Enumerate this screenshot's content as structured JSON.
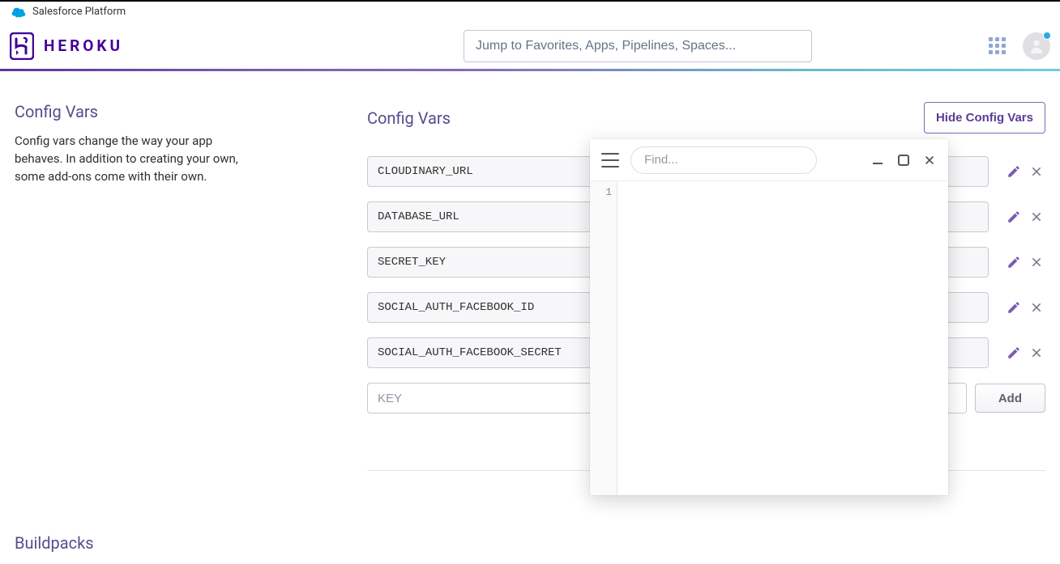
{
  "banner": {
    "platform": "Salesforce Platform"
  },
  "header": {
    "brand": "HEROKU",
    "search_placeholder": "Jump to Favorites, Apps, Pipelines, Spaces..."
  },
  "config": {
    "left_title": "Config Vars",
    "left_desc": "Config vars change the way your app behaves. In addition to creating your own, some add-ons come with their own.",
    "right_title": "Config Vars",
    "hide_button": "Hide Config Vars",
    "vars": [
      "CLOUDINARY_URL",
      "DATABASE_URL",
      "SECRET_KEY",
      "SOCIAL_AUTH_FACEBOOK_ID",
      "SOCIAL_AUTH_FACEBOOK_SECRET"
    ],
    "key_placeholder": "KEY",
    "add_button": "Add"
  },
  "buildpacks": {
    "title": "Buildpacks"
  },
  "find_panel": {
    "placeholder": "Find...",
    "line_number": "1"
  }
}
